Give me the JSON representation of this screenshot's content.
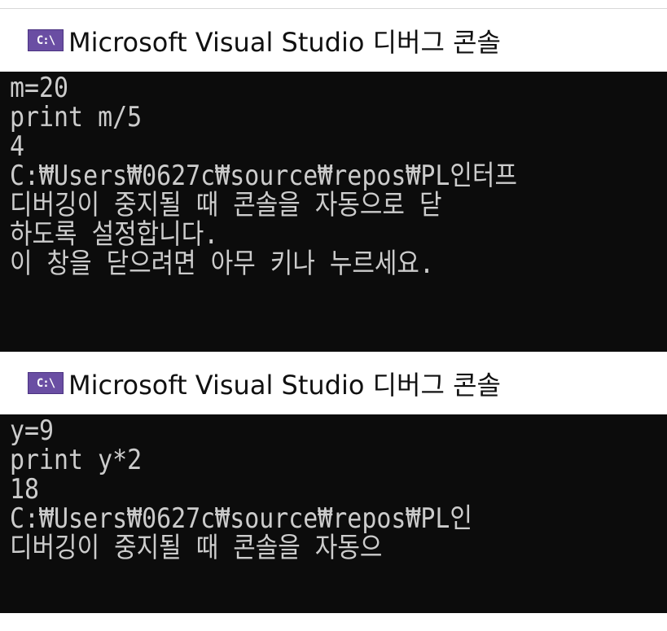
{
  "windows": [
    {
      "title": "Microsoft Visual Studio 디버그 콘솔",
      "icon": "console-app-icon",
      "icon_label": "C:\\",
      "lines": [
        "m=20",
        "print m/5",
        "4",
        "C:₩Users₩0627c₩source₩repos₩PL인터프",
        "디버깅이 중지될 때 콘솔을 자동으로 닫",
        "하도록 설정합니다.",
        "이 창을 닫으려면 아무 키나 누르세요."
      ]
    },
    {
      "title": "Microsoft Visual Studio 디버그 콘솔",
      "icon": "console-app-icon",
      "icon_label": "C:\\",
      "lines": [
        "y=9",
        "print y*2",
        "18",
        "C:₩Users₩0627c₩source₩repos₩PL인",
        "디버깅이 중지될 때 콘솔을 자동으"
      ]
    }
  ],
  "colors": {
    "console_bg": "#0c0c0c",
    "console_text": "#cccccc",
    "icon_bg": "#6a4ea3"
  }
}
